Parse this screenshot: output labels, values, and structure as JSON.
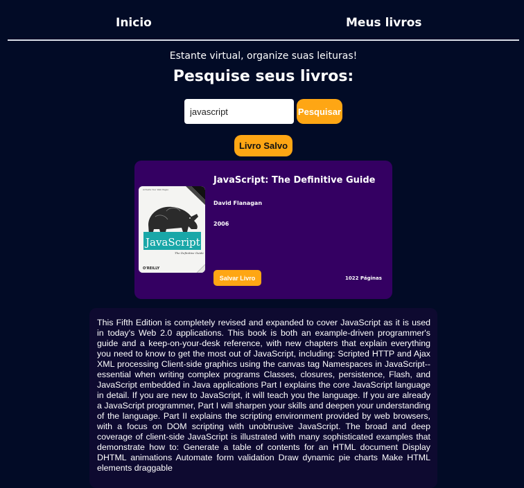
{
  "nav": {
    "home_label": "Inicio",
    "my_books_label": "Meus livros"
  },
  "hero": {
    "tagline": "Estante virtual, organize suas leituras!",
    "heading": "Pesquise seus livros:"
  },
  "search": {
    "value": "javascript",
    "button_label": "Pesquisar"
  },
  "saved_button_label": "Livro Salvo",
  "book": {
    "title": "JavaScript: The Definitive Guide",
    "author": "David Flanagan",
    "year": "2006",
    "save_label": "Salvar Livro",
    "pages": "1022 Páginas",
    "cover": {
      "top_text": "Activate Your Web Pages",
      "title": "JavaScript",
      "subtitle": "The Definitive Guide",
      "publisher": "O'REILLY"
    },
    "description": "This Fifth Edition is completely revised and expanded to cover JavaScript as it is used in today's Web 2.0 applications. This book is both an example-driven programmer's guide and a keep-on-your-desk reference, with new chapters that explain everything you need to know to get the most out of JavaScript, including: Scripted HTTP and Ajax XML processing Client-side graphics using the canvas tag Namespaces in JavaScript--essential when writing complex programs Classes, closures, persistence, Flash, and JavaScript embedded in Java applications Part I explains the core JavaScript language in detail. If you are new to JavaScript, it will teach you the language. If you are already a JavaScript programmer, Part I will sharpen your skills and deepen your understanding of the language. Part II explains the scripting environment provided by web browsers, with a focus on DOM scripting with unobtrusive JavaScript. The broad and deep coverage of client-side JavaScript is illustrated with many sophisticated examples that demonstrate how to: Generate a table of contents for an HTML document Display DHTML animations Automate form validation Draw dynamic pie charts Make HTML elements draggable"
  },
  "colors": {
    "background": "#020b26",
    "accent": "#fea614",
    "card": "#340062",
    "description_bg": "#0e0a30"
  }
}
